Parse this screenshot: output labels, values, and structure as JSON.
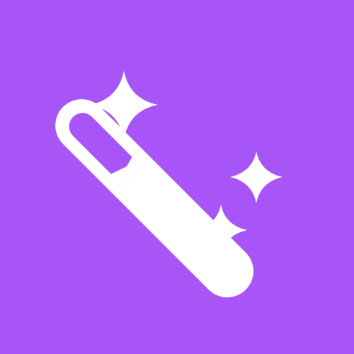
{
  "icon": {
    "name": "magic-wand-with-sparkles",
    "parts": {
      "wand": "magic-wand-icon",
      "sparkles": [
        "sparkle-large-icon",
        "sparkle-medium-icon",
        "sparkle-small-icon"
      ]
    }
  },
  "colors": {
    "background": "#a855f7",
    "foreground": "#ffffff"
  }
}
